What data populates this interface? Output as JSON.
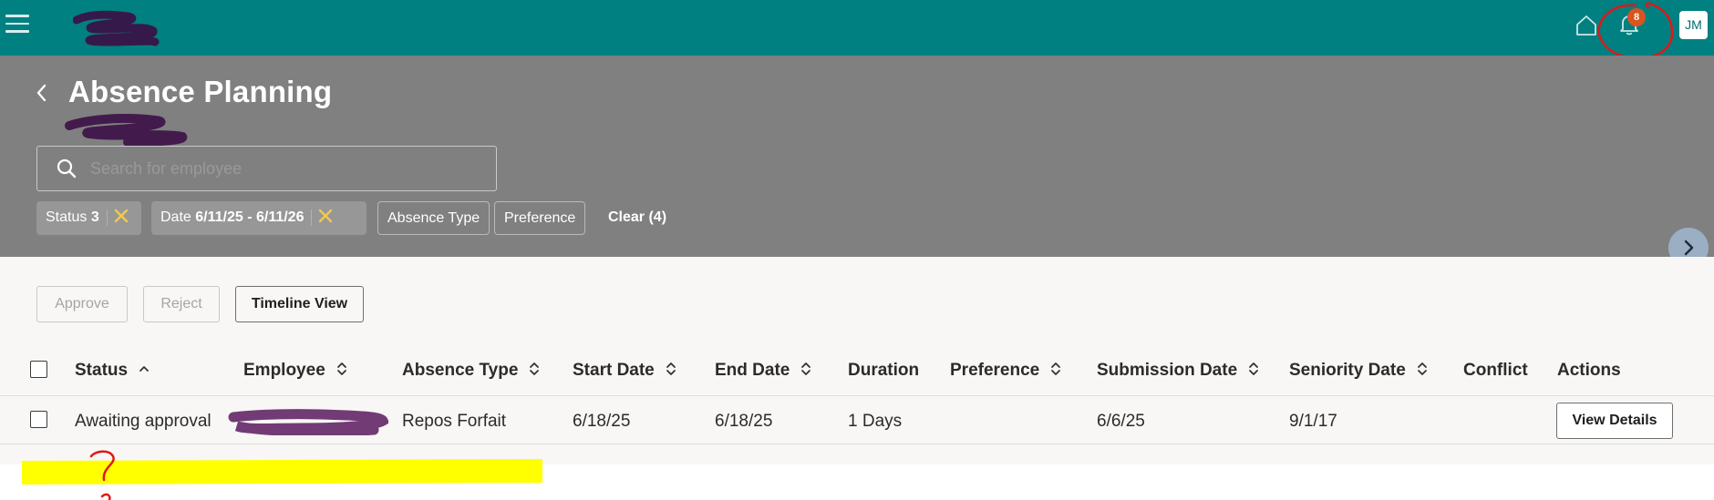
{
  "topbar": {
    "notification_count": "8",
    "avatar_initials": "JM",
    "colors": {
      "background": "#008080",
      "badge": "#d9541f"
    }
  },
  "header": {
    "title": "Absence Planning",
    "background": "#808080"
  },
  "search": {
    "placeholder": "Search for employee"
  },
  "filters": {
    "status_label": "Status",
    "status_value": "3",
    "date_label": "Date",
    "date_value": "6/11/25 - 6/11/26",
    "absence_type_label": "Absence Type",
    "preference_label": "Preference",
    "clear_label": "Clear (4)"
  },
  "toolbar": {
    "approve_label": "Approve",
    "reject_label": "Reject",
    "timeline_label": "Timeline View"
  },
  "table": {
    "columns": [
      "Status",
      "Employee",
      "Absence Type",
      "Start Date",
      "End Date",
      "Duration",
      "Preference",
      "Submission Date",
      "Seniority Date",
      "Conflict",
      "Actions"
    ],
    "rows": [
      {
        "status": "Awaiting approval",
        "employee": "",
        "absence_type": "Repos Forfait",
        "start_date": "6/18/25",
        "end_date": "6/18/25",
        "duration": "1 Days",
        "preference": "",
        "submission_date": "6/6/25",
        "seniority_date": "9/1/17",
        "conflict": "",
        "action_label": "View Details"
      }
    ]
  },
  "icons": [
    "hamburger-icon",
    "home-icon",
    "bell-icon",
    "chevron-left-icon",
    "search-icon",
    "close-icon",
    "chevron-right-icon",
    "sort-icon"
  ]
}
